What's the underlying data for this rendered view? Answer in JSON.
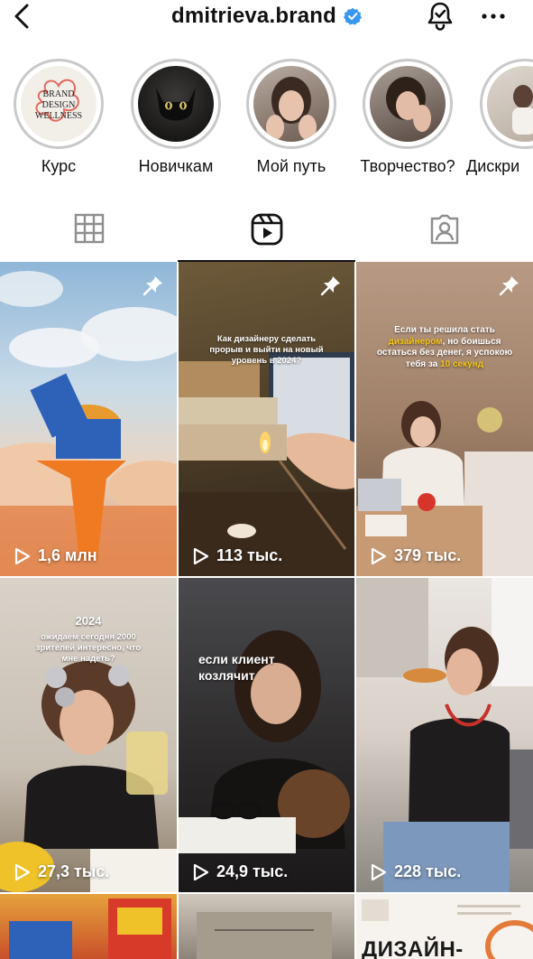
{
  "header": {
    "username": "dmitrieva.brand",
    "back_icon": "chevron-left-icon",
    "verified_icon": "verified-badge-icon",
    "bell_icon": "bell-icon",
    "more_icon": "more-horizontal-icon",
    "verified_color": "#3897f0"
  },
  "highlights": [
    {
      "label": "Курс",
      "icon": "brand-logo"
    },
    {
      "label": "Новичкам",
      "icon": "cat-photo"
    },
    {
      "label": "Мой путь",
      "icon": "portrait-photo"
    },
    {
      "label": "Творчество?",
      "icon": "portrait-photo"
    },
    {
      "label": "Дискри",
      "icon": "portrait-photo"
    }
  ],
  "highlight_logo_text": {
    "line1": "BRAND",
    "line2": "DESIGN",
    "line3": "WELLNESS"
  },
  "tabs": [
    {
      "name": "grid",
      "icon": "grid-icon",
      "active": false
    },
    {
      "name": "reels",
      "icon": "reels-icon",
      "active": true
    },
    {
      "name": "tagged",
      "icon": "tagged-person-icon",
      "active": false
    }
  ],
  "posts": [
    {
      "views": "1,6 млн",
      "pinned": true,
      "overlay": ""
    },
    {
      "views": "113 тыс.",
      "pinned": true,
      "overlay": "Как дизайнеру сделать прорыв и выйти на новый уровень в 2024?"
    },
    {
      "views": "379 тыс.",
      "pinned": true,
      "overlay_parts": [
        "Если ты решила стать ",
        "дизайнером",
        ", но боишься остаться без денег, я успокою тебя за ",
        "10 секунд"
      ]
    },
    {
      "views": "27,3 тыс.",
      "pinned": false,
      "overlay_title": "2024",
      "overlay": "ожидаем сегодня 2000 зрителей интересно, что мне надеть?"
    },
    {
      "views": "24,9 тыс.",
      "pinned": false,
      "overlay": "если клиент козлячит"
    },
    {
      "views": "228 тыс.",
      "pinned": false,
      "overlay": ""
    },
    {
      "views": "",
      "pinned": false,
      "overlay": ""
    },
    {
      "views": "",
      "pinned": false,
      "overlay": ""
    },
    {
      "views": "",
      "pinned": false,
      "overlay": "ДИЗАЙН-"
    }
  ],
  "colors": {
    "accent_yellow": "#f5c518",
    "tab_active": "#111111",
    "tab_inactive": "#8e8e8e"
  }
}
